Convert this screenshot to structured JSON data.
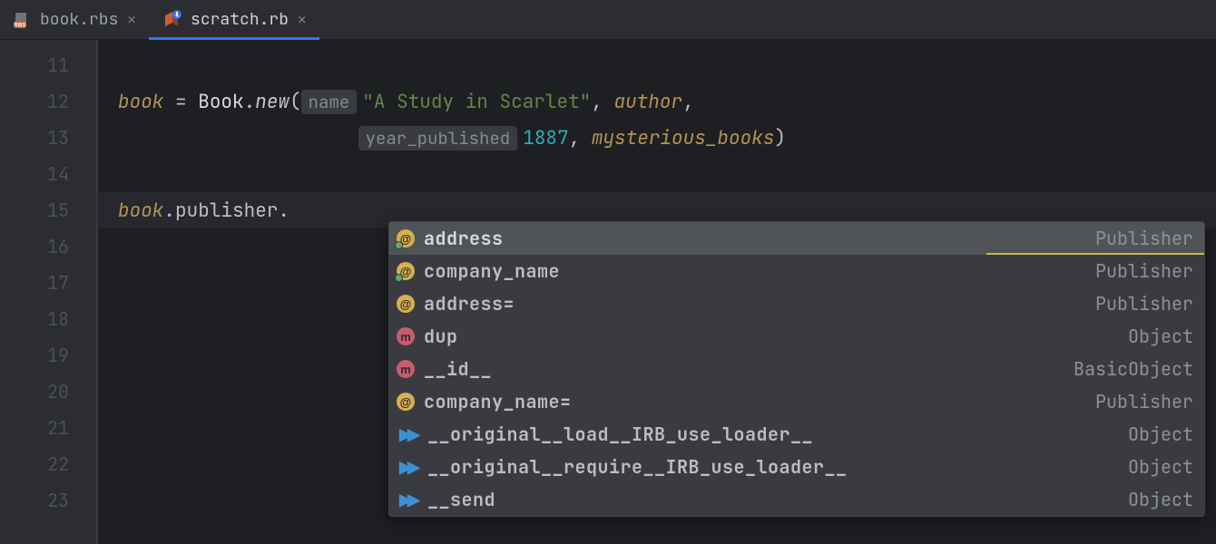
{
  "tabs": [
    {
      "label": "book.rbs",
      "active": false
    },
    {
      "label": "scratch.rb",
      "active": true
    }
  ],
  "gutter": [
    "11",
    "12",
    "13",
    "14",
    "15",
    "16",
    "17",
    "18",
    "19",
    "20",
    "21",
    "22",
    "23"
  ],
  "code": {
    "l12": {
      "var": "book",
      "eq": " = ",
      "klass": "Book",
      "dot": ".",
      "newm": "new",
      "lpar": "(",
      "hint1": "name",
      "str": "\"A Study in Scarlet\"",
      "comma1": ", ",
      "kw1": "author",
      "comma2": ","
    },
    "l13": {
      "indent": "                     ",
      "hint2": "year_published",
      "num": "1887",
      "comma": ", ",
      "kw2": "mysterious_books",
      "rpar": ")"
    },
    "l15": {
      "var": "book",
      "dot1": ".",
      "m1": "publisher",
      "dot2": "."
    }
  },
  "popup": [
    {
      "icon": "attr-green",
      "glyph": "@",
      "name": "address",
      "type": "Publisher",
      "selected": true
    },
    {
      "icon": "attr-green",
      "glyph": "@",
      "name": "company_name",
      "type": "Publisher"
    },
    {
      "icon": "attr",
      "glyph": "@",
      "name": "address=",
      "type": "Publisher"
    },
    {
      "icon": "method",
      "glyph": "m",
      "name": "dup",
      "type": "Object"
    },
    {
      "icon": "method",
      "glyph": "m",
      "name": "__id__",
      "type": "BasicObject"
    },
    {
      "icon": "attr",
      "glyph": "@",
      "name": "company_name=",
      "type": "Publisher"
    },
    {
      "icon": "arrow",
      "glyph": "▶▶",
      "name": "__original__load__IRB_use_loader__",
      "type": "Object"
    },
    {
      "icon": "arrow",
      "glyph": "▶▶",
      "name": "__original__require__IRB_use_loader__",
      "type": "Object"
    },
    {
      "icon": "arrow",
      "glyph": "▶▶",
      "name": "__send",
      "type": "Object"
    }
  ]
}
